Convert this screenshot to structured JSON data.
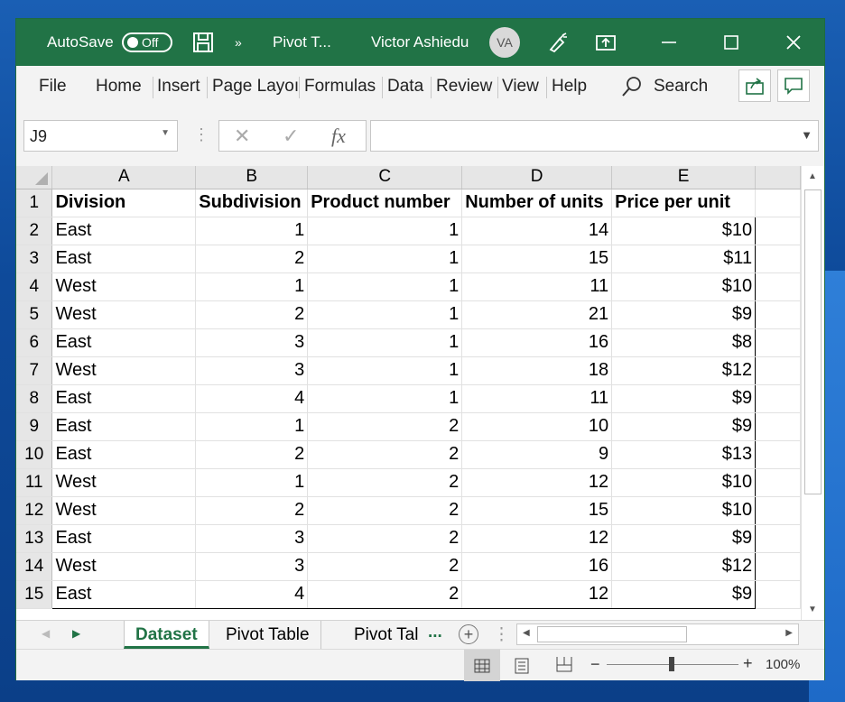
{
  "titlebar": {
    "autosave_label": "AutoSave",
    "autosave_state": "Off",
    "file_title": "Pivot T...",
    "user_name": "Victor Ashiedu",
    "user_initials": "VA",
    "more_glyph": "»"
  },
  "menu": {
    "items": [
      "File",
      "Home",
      "Insert",
      "Page Layoı",
      "Formulas",
      "Data",
      "Review",
      "View",
      "Help"
    ],
    "search_label": "Search"
  },
  "namebox": {
    "value": "J9"
  },
  "formula_bar": {
    "fx_label": "fx",
    "value": ""
  },
  "columns": [
    "A",
    "B",
    "C",
    "D",
    "E"
  ],
  "header_row": {
    "row": "1",
    "cells": [
      "Division",
      "Subdivision",
      "Product number",
      "Number of units",
      "Price per unit"
    ]
  },
  "rows": [
    {
      "row": "2",
      "cells": [
        "East",
        "1",
        "1",
        "14",
        "$10"
      ]
    },
    {
      "row": "3",
      "cells": [
        "East",
        "2",
        "1",
        "15",
        "$11"
      ]
    },
    {
      "row": "4",
      "cells": [
        "West",
        "1",
        "1",
        "11",
        "$10"
      ]
    },
    {
      "row": "5",
      "cells": [
        "West",
        "2",
        "1",
        "21",
        "$9"
      ]
    },
    {
      "row": "6",
      "cells": [
        "East",
        "3",
        "1",
        "16",
        "$8"
      ]
    },
    {
      "row": "7",
      "cells": [
        "West",
        "3",
        "1",
        "18",
        "$12"
      ]
    },
    {
      "row": "8",
      "cells": [
        "East",
        "4",
        "1",
        "11",
        "$9"
      ]
    },
    {
      "row": "9",
      "cells": [
        "East",
        "1",
        "2",
        "10",
        "$9"
      ]
    },
    {
      "row": "10",
      "cells": [
        "East",
        "2",
        "2",
        "9",
        "$13"
      ]
    },
    {
      "row": "11",
      "cells": [
        "West",
        "1",
        "2",
        "12",
        "$10"
      ]
    },
    {
      "row": "12",
      "cells": [
        "West",
        "2",
        "2",
        "15",
        "$10"
      ]
    },
    {
      "row": "13",
      "cells": [
        "East",
        "3",
        "2",
        "12",
        "$9"
      ]
    },
    {
      "row": "14",
      "cells": [
        "West",
        "3",
        "2",
        "16",
        "$12"
      ]
    },
    {
      "row": "15",
      "cells": [
        "East",
        "4",
        "2",
        "12",
        "$9"
      ]
    }
  ],
  "sheets": {
    "tabs": [
      "Dataset",
      "Pivot Table",
      "Pivot Tal"
    ],
    "active": "Dataset",
    "more_glyph": "..."
  },
  "status": {
    "zoom": "100%"
  },
  "colors": {
    "accent": "#217346",
    "titlebar": "#217346"
  }
}
